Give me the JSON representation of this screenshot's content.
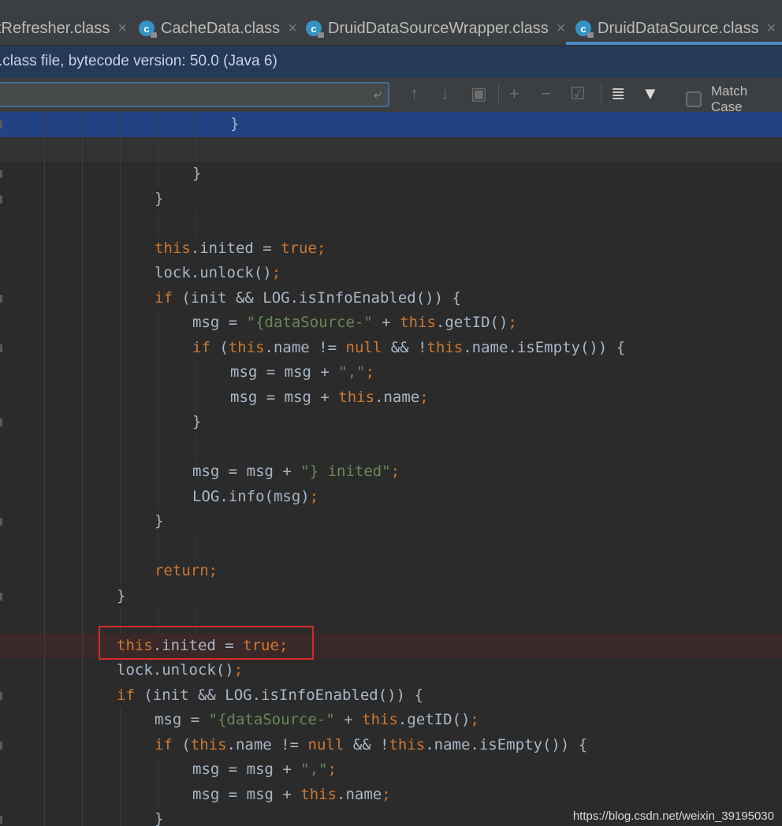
{
  "tabs": [
    {
      "label": "tRefresher.class",
      "active": false,
      "has_icon": false
    },
    {
      "label": "CacheData.class",
      "active": false,
      "has_icon": true
    },
    {
      "label": "DruidDataSourceWrapper.class",
      "active": false,
      "has_icon": true
    },
    {
      "label": "DruidDataSource.class",
      "active": true,
      "has_icon": true
    }
  ],
  "tab_close_glyph": "×",
  "class_icon_letter": "c",
  "info_bar": {
    "text": ".class file, bytecode version: 50.0 (Java 6)"
  },
  "search": {
    "value": "",
    "placeholder": "",
    "match_case_label": "Match Case",
    "match_case_checked": false
  },
  "toolbar_icons": [
    "up-arrow-icon",
    "down-arrow-icon",
    "select-all-occurrences-icon",
    "add-selection-icon",
    "remove-selection-icon",
    "select-all-icon",
    "filter-lines-icon",
    "filter-icon"
  ],
  "code_lines": [
    {
      "indent": 6,
      "highlight": "blue",
      "tokens": [
        {
          "t": "}",
          "c": "p"
        }
      ]
    },
    {
      "indent": 0,
      "highlight": "grey",
      "tokens": []
    },
    {
      "indent": 5,
      "highlight": "",
      "tokens": [
        {
          "t": "}",
          "c": "p"
        }
      ]
    },
    {
      "indent": 4,
      "highlight": "",
      "tokens": [
        {
          "t": "}",
          "c": "p"
        }
      ]
    },
    {
      "indent": 0,
      "highlight": "",
      "tokens": []
    },
    {
      "indent": 4,
      "highlight": "",
      "tokens": [
        {
          "t": "this",
          "c": "kw"
        },
        {
          "t": ".inited = ",
          "c": "p"
        },
        {
          "t": "true",
          "c": "kw"
        },
        {
          "t": ";",
          "c": "kw"
        }
      ]
    },
    {
      "indent": 4,
      "highlight": "",
      "tokens": [
        {
          "t": "lock.unlock()",
          "c": "p"
        },
        {
          "t": ";",
          "c": "kw"
        }
      ]
    },
    {
      "indent": 4,
      "highlight": "",
      "tokens": [
        {
          "t": "if",
          "c": "kw"
        },
        {
          "t": " (init && LOG.isInfoEnabled()) {",
          "c": "p"
        }
      ]
    },
    {
      "indent": 5,
      "highlight": "",
      "tokens": [
        {
          "t": "msg = ",
          "c": "p"
        },
        {
          "t": "\"{dataSource-\"",
          "c": "str"
        },
        {
          "t": " + ",
          "c": "p"
        },
        {
          "t": "this",
          "c": "kw"
        },
        {
          "t": ".getID()",
          "c": "p"
        },
        {
          "t": ";",
          "c": "kw"
        }
      ]
    },
    {
      "indent": 5,
      "highlight": "",
      "tokens": [
        {
          "t": "if",
          "c": "kw"
        },
        {
          "t": " (",
          "c": "p"
        },
        {
          "t": "this",
          "c": "kw"
        },
        {
          "t": ".name != ",
          "c": "p"
        },
        {
          "t": "null",
          "c": "kw"
        },
        {
          "t": " && !",
          "c": "p"
        },
        {
          "t": "this",
          "c": "kw"
        },
        {
          "t": ".name.isEmpty()) {",
          "c": "p"
        }
      ]
    },
    {
      "indent": 6,
      "highlight": "",
      "tokens": [
        {
          "t": "msg = msg + ",
          "c": "p"
        },
        {
          "t": "\",\"",
          "c": "str"
        },
        {
          "t": ";",
          "c": "kw"
        }
      ]
    },
    {
      "indent": 6,
      "highlight": "",
      "tokens": [
        {
          "t": "msg = msg + ",
          "c": "p"
        },
        {
          "t": "this",
          "c": "kw"
        },
        {
          "t": ".name",
          "c": "p"
        },
        {
          "t": ";",
          "c": "kw"
        }
      ]
    },
    {
      "indent": 5,
      "highlight": "",
      "tokens": [
        {
          "t": "}",
          "c": "p"
        }
      ]
    },
    {
      "indent": 0,
      "highlight": "",
      "tokens": []
    },
    {
      "indent": 5,
      "highlight": "",
      "tokens": [
        {
          "t": "msg = msg + ",
          "c": "p"
        },
        {
          "t": "\"} inited\"",
          "c": "str"
        },
        {
          "t": ";",
          "c": "kw"
        }
      ]
    },
    {
      "indent": 5,
      "highlight": "",
      "tokens": [
        {
          "t": "LOG.info(msg)",
          "c": "p"
        },
        {
          "t": ";",
          "c": "kw"
        }
      ]
    },
    {
      "indent": 4,
      "highlight": "",
      "tokens": [
        {
          "t": "}",
          "c": "p"
        }
      ]
    },
    {
      "indent": 0,
      "highlight": "",
      "tokens": []
    },
    {
      "indent": 4,
      "highlight": "",
      "tokens": [
        {
          "t": "return;",
          "c": "kw"
        }
      ]
    },
    {
      "indent": 3,
      "highlight": "",
      "tokens": [
        {
          "t": "}",
          "c": "p"
        }
      ]
    },
    {
      "indent": 0,
      "highlight": "",
      "tokens": []
    },
    {
      "indent": 3,
      "highlight": "red",
      "tokens": [
        {
          "t": "this",
          "c": "kw"
        },
        {
          "t": ".inited = ",
          "c": "p"
        },
        {
          "t": "true",
          "c": "kw"
        },
        {
          "t": ";",
          "c": "kw"
        }
      ]
    },
    {
      "indent": 3,
      "highlight": "",
      "tokens": [
        {
          "t": "lock.unlock()",
          "c": "p"
        },
        {
          "t": ";",
          "c": "kw"
        }
      ]
    },
    {
      "indent": 3,
      "highlight": "",
      "tokens": [
        {
          "t": "if",
          "c": "kw"
        },
        {
          "t": " (init && LOG.isInfoEnabled()) {",
          "c": "p"
        }
      ]
    },
    {
      "indent": 4,
      "highlight": "",
      "tokens": [
        {
          "t": "msg = ",
          "c": "p"
        },
        {
          "t": "\"{dataSource-\"",
          "c": "str"
        },
        {
          "t": " + ",
          "c": "p"
        },
        {
          "t": "this",
          "c": "kw"
        },
        {
          "t": ".getID()",
          "c": "p"
        },
        {
          "t": ";",
          "c": "kw"
        }
      ]
    },
    {
      "indent": 4,
      "highlight": "",
      "tokens": [
        {
          "t": "if",
          "c": "kw"
        },
        {
          "t": " (",
          "c": "p"
        },
        {
          "t": "this",
          "c": "kw"
        },
        {
          "t": ".name != ",
          "c": "p"
        },
        {
          "t": "null",
          "c": "kw"
        },
        {
          "t": " && !",
          "c": "p"
        },
        {
          "t": "this",
          "c": "kw"
        },
        {
          "t": ".name.isEmpty()) {",
          "c": "p"
        }
      ]
    },
    {
      "indent": 5,
      "highlight": "",
      "tokens": [
        {
          "t": "msg = msg + ",
          "c": "p"
        },
        {
          "t": "\",\"",
          "c": "str"
        },
        {
          "t": ";",
          "c": "kw"
        }
      ]
    },
    {
      "indent": 5,
      "highlight": "",
      "tokens": [
        {
          "t": "msg = msg + ",
          "c": "p"
        },
        {
          "t": "this",
          "c": "kw"
        },
        {
          "t": ".name",
          "c": "p"
        },
        {
          "t": ";",
          "c": "kw"
        }
      ]
    },
    {
      "indent": 4,
      "highlight": "",
      "tokens": [
        {
          "t": "}",
          "c": "p"
        }
      ]
    }
  ],
  "watermark": "https://blog.csdn.net/weixin_39195030",
  "colors": {
    "background": "#2b2b2b",
    "keyword": "#cc7832",
    "string": "#6a8759",
    "plain": "#a9b7c6",
    "selection": "#214283",
    "info_bar": "#243a57",
    "red_box": "#d42b2b"
  }
}
